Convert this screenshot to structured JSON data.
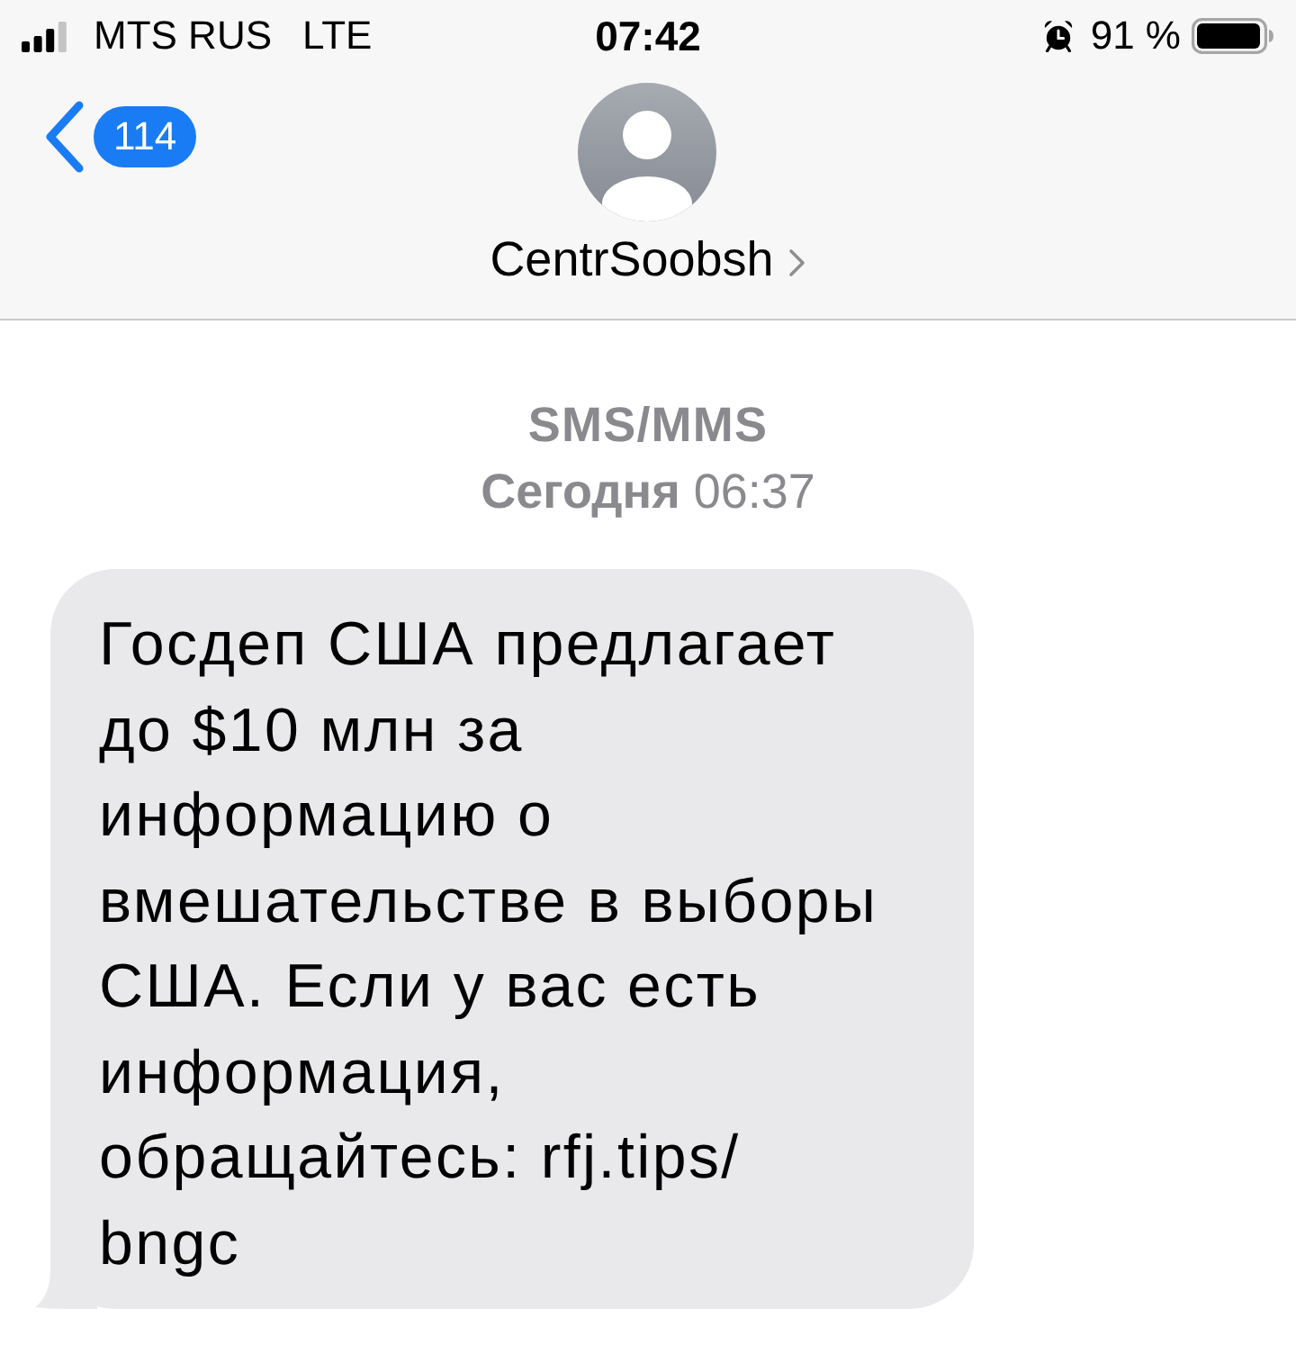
{
  "status_bar": {
    "carrier": "MTS RUS",
    "network": "LTE",
    "time": "07:42",
    "battery_percent": "91 %"
  },
  "nav_bar": {
    "back_badge": "114",
    "contact_name": "CentrSoobsh"
  },
  "thread_header": {
    "service": "SMS/MMS",
    "timestamp": "**Сегодня** 06:37"
  },
  "messages": [
    {
      "kind": "incoming",
      "lines": [
        "Госдеп США предлагает",
        "до $10 млн за",
        "информацию о",
        "вмешательстве в выборы",
        "США. Если у вас есть",
        "информация,",
        "обращайтесь: rfj.tips/",
        "bngc"
      ]
    }
  ]
}
